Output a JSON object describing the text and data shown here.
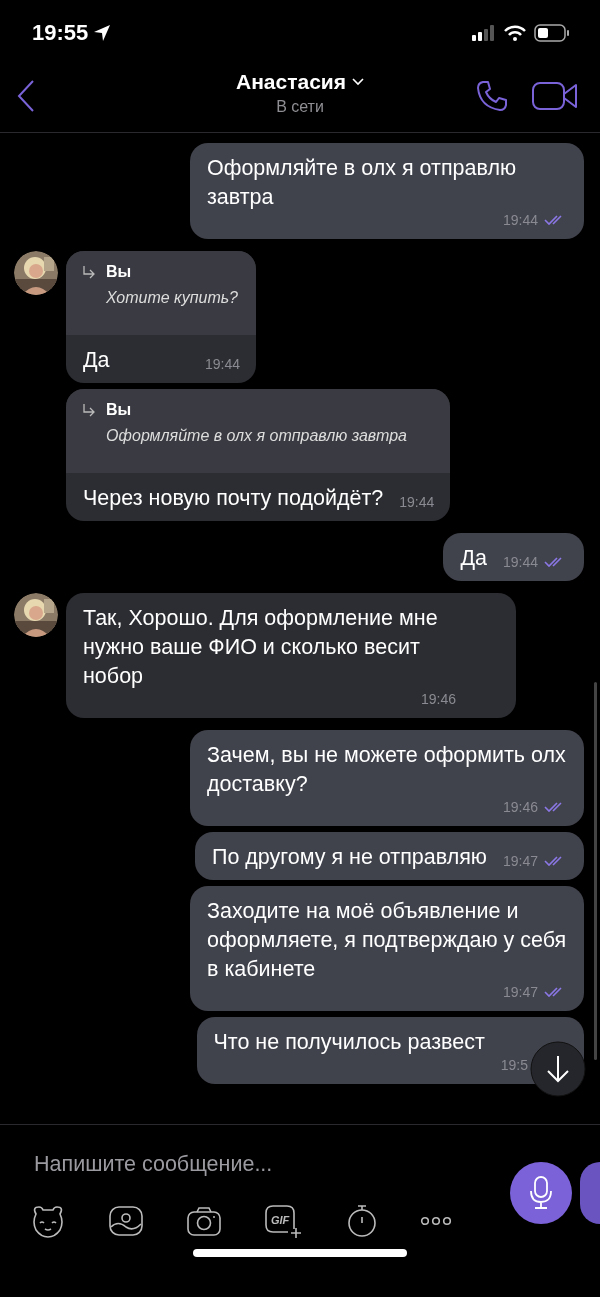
{
  "status_bar": {
    "time": "19:55"
  },
  "header": {
    "title": "Анастасия",
    "status": "В сети"
  },
  "messages": [
    {
      "kind": "outgoing",
      "text": "Оформляйте в олх я отправлю завтра",
      "time": "19:44",
      "read": true
    },
    {
      "kind": "incoming",
      "avatar": true,
      "reply": {
        "author": "Вы",
        "text": "Хотите купить?"
      },
      "text": "Да",
      "time": "19:44"
    },
    {
      "kind": "incoming",
      "avatar": false,
      "reply": {
        "author": "Вы",
        "text": "Оформляйте в олх я отправлю завтра"
      },
      "text": "Через новую почту подойдёт?",
      "time": "19:44"
    },
    {
      "kind": "outgoing",
      "text": "Да",
      "time": "19:44",
      "read": true
    },
    {
      "kind": "incoming",
      "avatar": true,
      "text": "Так, Хорошо. Для оформление мне нужно ваше ФИО и сколько весит нобор",
      "time": "19:46"
    },
    {
      "kind": "outgoing",
      "text": "Зачем, вы не можете оформить олх доставку?",
      "time": "19:46",
      "read": true
    },
    {
      "kind": "outgoing",
      "text": "По другому я не отправляю",
      "time": "19:47",
      "read": true
    },
    {
      "kind": "outgoing",
      "text": "Заходите на моё объявление и оформляете, я подтверждаю у себя в кабинете",
      "time": "19:47",
      "read": true
    },
    {
      "kind": "outgoing",
      "text": "Что не получилось развест",
      "time": "19:5"
    }
  ],
  "composer": {
    "placeholder": "Напишите сообщение...",
    "gif_label": "GIF"
  }
}
